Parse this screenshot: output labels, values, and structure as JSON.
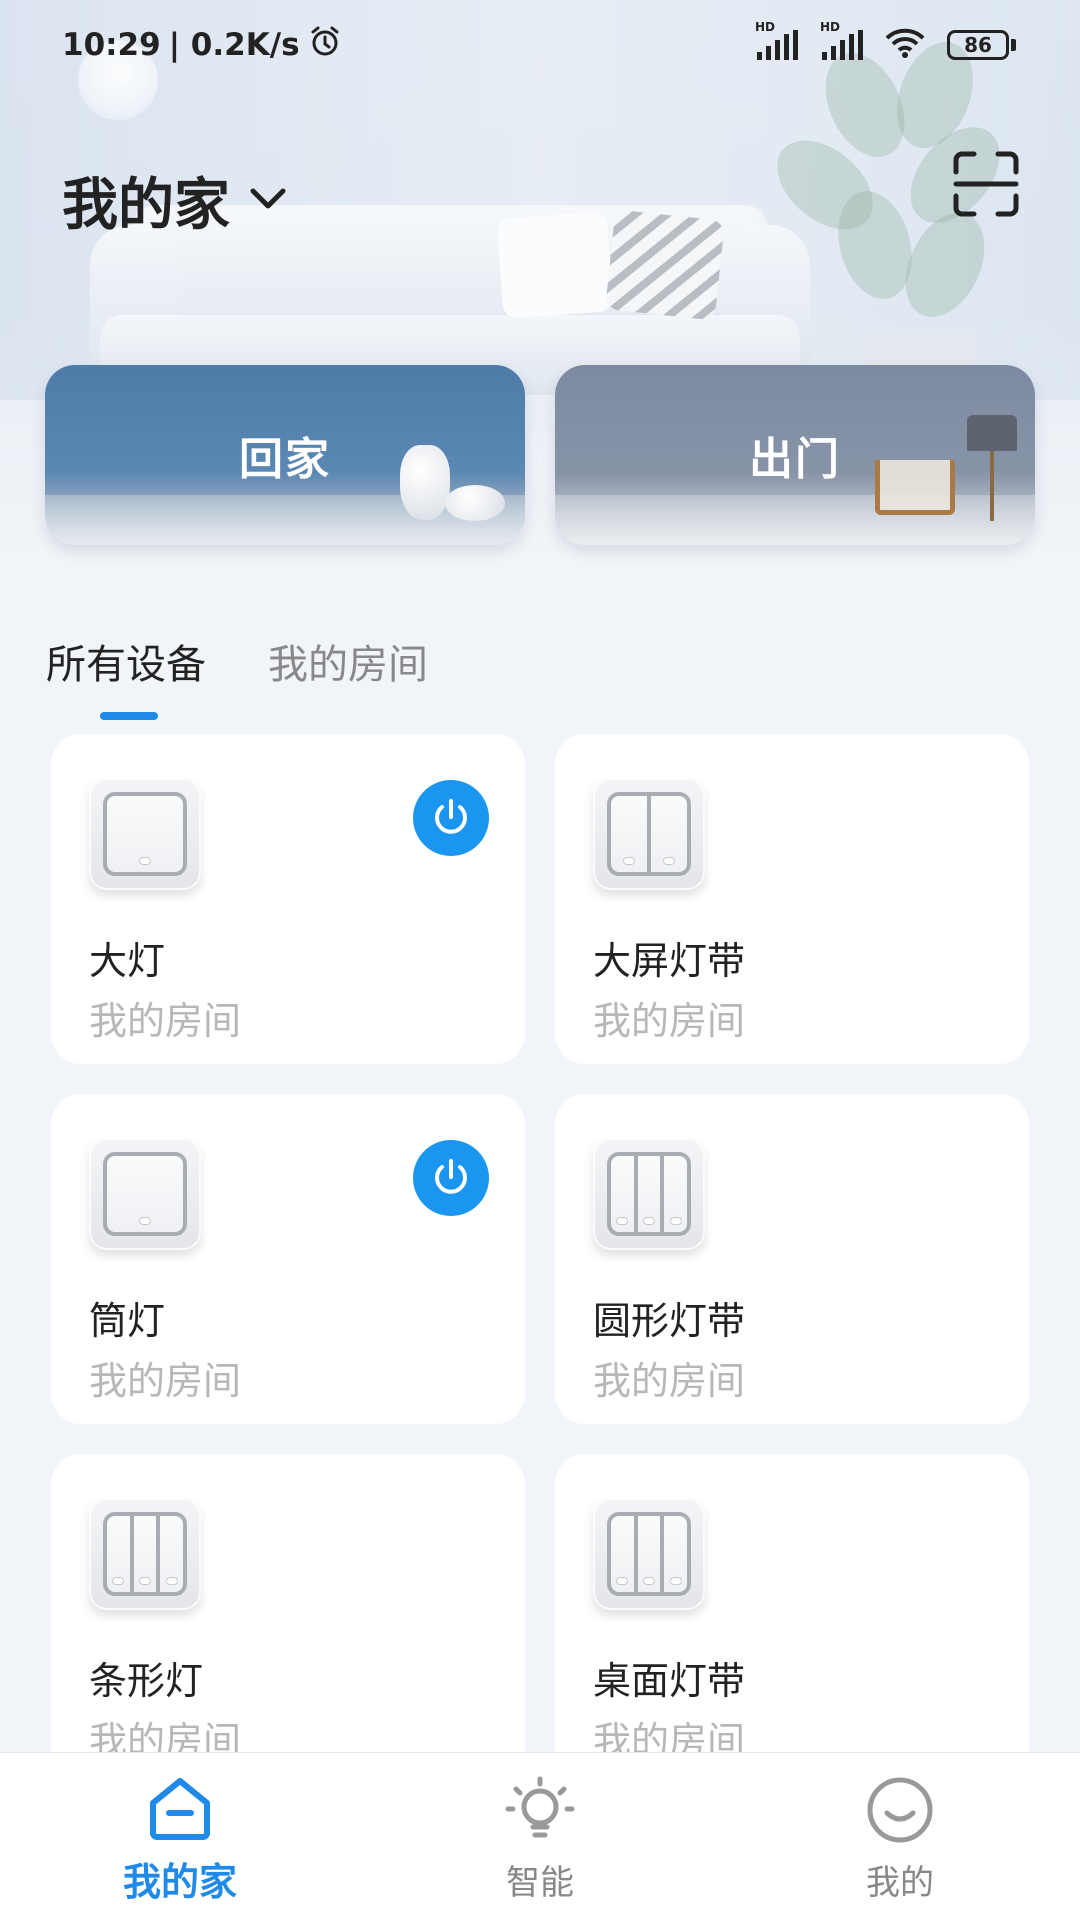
{
  "status_bar": {
    "time": "10:29",
    "net_speed": "| 0.2K/s",
    "battery": "86"
  },
  "header": {
    "home_name": "我的家"
  },
  "scenes": [
    {
      "label": "回家"
    },
    {
      "label": "出门"
    }
  ],
  "tabs": [
    {
      "label": "所有设备",
      "active": true
    },
    {
      "label": "我的房间",
      "active": false
    }
  ],
  "devices": [
    {
      "name": "大灯",
      "room": "我的房间",
      "gangs": 1,
      "power_on": true
    },
    {
      "name": "大屏灯带",
      "room": "我的房间",
      "gangs": 2,
      "power_on": false
    },
    {
      "name": "筒灯",
      "room": "我的房间",
      "gangs": 1,
      "power_on": true
    },
    {
      "name": "圆形灯带",
      "room": "我的房间",
      "gangs": 3,
      "power_on": false
    },
    {
      "name": "条形灯",
      "room": "我的房间",
      "gangs": 3,
      "power_on": false
    },
    {
      "name": "桌面灯带",
      "room": "我的房间",
      "gangs": 3,
      "power_on": false
    }
  ],
  "bottom_nav": [
    {
      "label": "我的家",
      "icon": "home-icon",
      "active": true
    },
    {
      "label": "智能",
      "icon": "bulb-icon",
      "active": false
    },
    {
      "label": "我的",
      "icon": "smile-icon",
      "active": false
    }
  ],
  "colors": {
    "accent": "#1f8ae8",
    "power_button": "#1a96f0",
    "card_background": "#ffffff",
    "page_background": "#f1f4f8"
  }
}
